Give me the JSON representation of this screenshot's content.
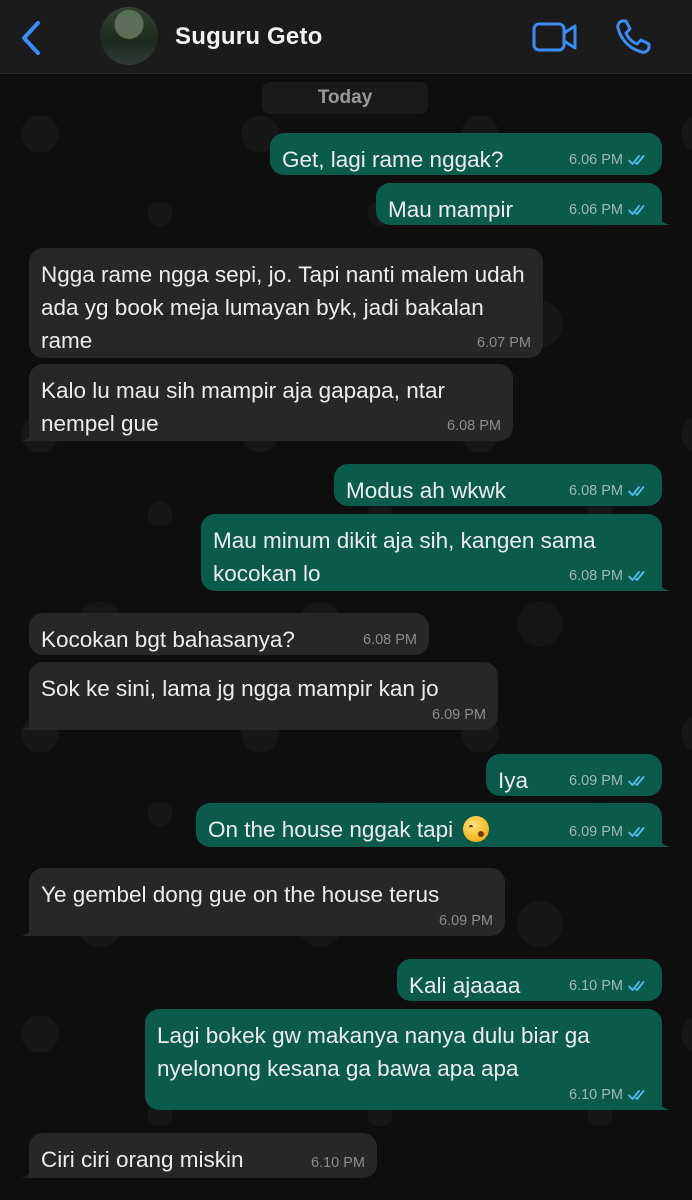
{
  "header": {
    "contact_name": "Suguru Geto",
    "icons": {
      "back": "chevron-left-icon",
      "video": "video-call-icon",
      "call": "phone-icon"
    },
    "accent_color": "#3b8cf6"
  },
  "date_separator": "Today",
  "colors": {
    "outgoing_bubble": "#0b5b4d",
    "incoming_bubble": "#272727",
    "read_ticks": "#53bdeb"
  },
  "messages": [
    {
      "direction": "out",
      "text": "Get, lagi rame nggak?",
      "time": "6.06 PM",
      "status": "read"
    },
    {
      "direction": "out",
      "text": "Mau mampir",
      "time": "6.06 PM",
      "status": "read"
    },
    {
      "direction": "in",
      "text": "Ngga rame ngga sepi, jo. Tapi nanti malem udah ada yg book meja lumayan byk, jadi bakalan rame",
      "time": "6.07 PM"
    },
    {
      "direction": "in",
      "text": "Kalo lu mau sih mampir aja gapapa, ntar nempel gue",
      "time": "6.08 PM"
    },
    {
      "direction": "out",
      "text": "Modus ah wkwk",
      "time": "6.08 PM",
      "status": "read"
    },
    {
      "direction": "out",
      "text": "Mau minum dikit aja sih, kangen sama kocokan lo",
      "time": "6.08 PM",
      "status": "read"
    },
    {
      "direction": "in",
      "text": "Kocokan bgt bahasanya?",
      "time": "6.08 PM"
    },
    {
      "direction": "in",
      "text": "Sok ke sini, lama jg ngga mampir kan jo",
      "time": "6.09 PM"
    },
    {
      "direction": "out",
      "text": "Iya",
      "time": "6.09 PM",
      "status": "read"
    },
    {
      "direction": "out",
      "text": "On the house nggak tapi",
      "emoji": "kissing-face-emoji",
      "time": "6.09 PM",
      "status": "read"
    },
    {
      "direction": "in",
      "text": "Ye gembel dong gue on the house terus",
      "time": "6.09 PM"
    },
    {
      "direction": "out",
      "text": "Kali ajaaaa",
      "time": "6.10 PM",
      "status": "read"
    },
    {
      "direction": "out",
      "text": "Lagi bokek gw makanya nanya dulu biar ga nyelonong kesana ga bawa apa apa",
      "time": "6.10 PM",
      "status": "read"
    },
    {
      "direction": "in",
      "text": "Ciri ciri orang miskin",
      "time": "6.10 PM"
    }
  ]
}
